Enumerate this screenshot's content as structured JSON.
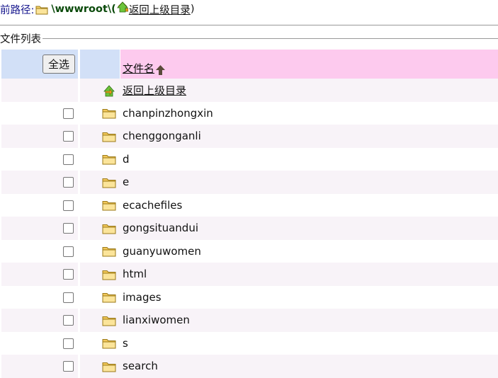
{
  "path": {
    "label": "前路径:",
    "root": "\\wwwroot\\(",
    "up_link": "返回上级目录",
    "close": ")"
  },
  "legend": "文件列表",
  "table_header": {
    "select_all": "全选",
    "name_sort": "文件名"
  },
  "parent_row": {
    "label": "返回上级目录"
  },
  "rows": [
    {
      "name": "chanpinzhongxin"
    },
    {
      "name": "chenggonganli"
    },
    {
      "name": "d"
    },
    {
      "name": "e"
    },
    {
      "name": "ecachefiles"
    },
    {
      "name": "gongsituandui"
    },
    {
      "name": "guanyuwomen"
    },
    {
      "name": "html"
    },
    {
      "name": "images"
    },
    {
      "name": "lianxiwomen"
    },
    {
      "name": "s"
    },
    {
      "name": "search"
    }
  ],
  "colors": {
    "header_blue": "#d2e0f7",
    "header_pink": "#fdcaee",
    "row_alt": "#f8f3f8",
    "path_label": "#14148c",
    "path_root": "#0b4a0b"
  }
}
